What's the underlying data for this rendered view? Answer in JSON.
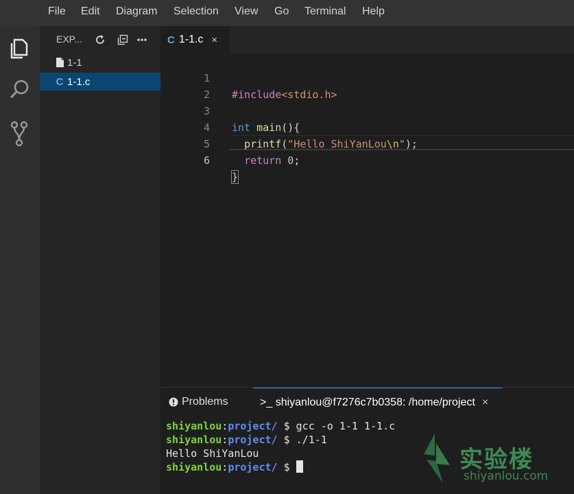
{
  "menu": {
    "items": [
      "File",
      "Edit",
      "Diagram",
      "Selection",
      "View",
      "Go",
      "Terminal",
      "Help"
    ]
  },
  "activity_bar": {
    "icons": [
      "explorer-icon",
      "search-icon",
      "source-control-icon"
    ]
  },
  "explorer": {
    "title": "EXP...",
    "actions": [
      "refresh-icon",
      "collapse-all-icon",
      "more-icon"
    ],
    "files": [
      {
        "name": "1-1",
        "icon": "file-icon",
        "active": false
      },
      {
        "name": "1-1.c",
        "icon": "c-file-icon",
        "active": true
      }
    ]
  },
  "editor": {
    "tab": {
      "label": "1-1.c",
      "icon": "c-file-icon",
      "close": "×"
    },
    "line_numbers": [
      "1",
      "2",
      "3",
      "4",
      "5",
      "6"
    ],
    "current_line": "6",
    "code": {
      "l1_directive": "#include",
      "l1_header": "<stdio.h>",
      "l3_type": "int",
      "l3_func": "main",
      "l3_rest": "(){",
      "l4_indent": "  ",
      "l4_func": "printf",
      "l4_open": "(",
      "l4_str_a": "\"Hello ShiYanLou",
      "l4_escape": "\\n",
      "l4_str_b": "\"",
      "l4_close": ");",
      "l5_indent": "  ",
      "l5_kw": "return",
      "l5_sp": " ",
      "l5_num": "0",
      "l5_semi": ";",
      "l6_brace": "}"
    }
  },
  "panel": {
    "problems_label": "Problems",
    "terminal_label": "shiyanlou@f7276c7b0358: /home/project",
    "terminal_prefix": ">_",
    "close": "×",
    "terminal": {
      "user": "shiyanlou",
      "colon": ":",
      "path": "project/",
      "prompt": " $ ",
      "cmd1": "gcc -o 1-1 1-1.c",
      "cmd2": "./1-1",
      "output": "Hello ShiYanLou"
    }
  },
  "watermark": {
    "text": "实验楼",
    "sub": "shiyanlou.com"
  },
  "colors": {
    "accent": "#3794ff",
    "selection": "#094771",
    "terminal_user": "#7fd33f",
    "terminal_path": "#5c8ff0",
    "watermark": "#3f8a55"
  }
}
